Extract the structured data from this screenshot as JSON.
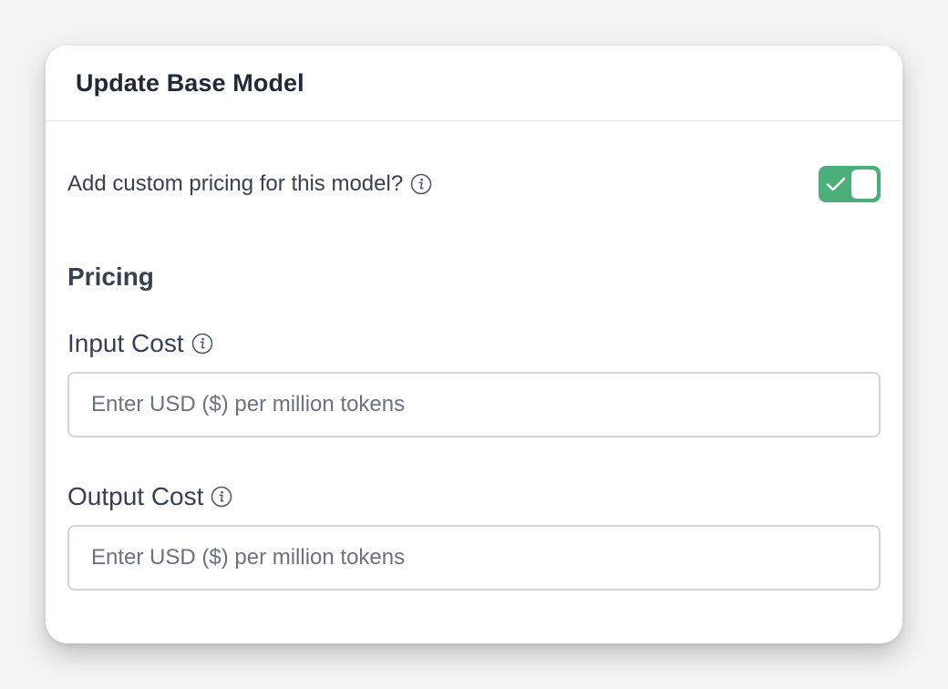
{
  "modal": {
    "title": "Update Base Model"
  },
  "custom_pricing": {
    "label": "Add custom pricing for this model?",
    "info_icon": "info-circle-icon",
    "enabled": true,
    "toggle_color": "#4caf7a",
    "check_icon": "check-icon"
  },
  "pricing": {
    "heading": "Pricing",
    "input_cost": {
      "label": "Input Cost",
      "placeholder": "Enter USD ($) per million tokens",
      "value": ""
    },
    "output_cost": {
      "label": "Output Cost",
      "placeholder": "Enter USD ($) per million tokens",
      "value": ""
    }
  }
}
